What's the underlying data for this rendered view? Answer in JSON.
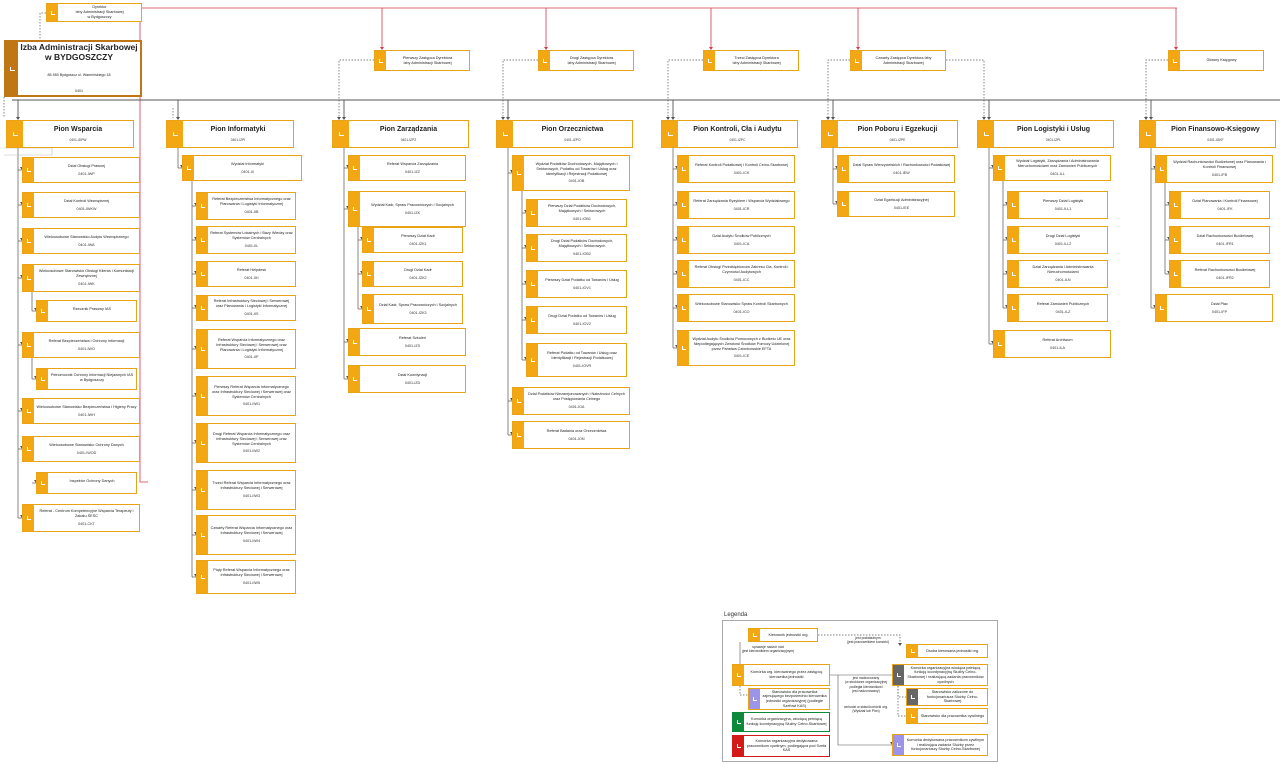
{
  "colors": {
    "accent": "#f3a712",
    "main": "#c07615",
    "grey": "#666666",
    "purple": "#9b94e8",
    "green": "#0c8a3a",
    "red": "#d41919",
    "line": "#555555",
    "redline": "#d43a4a"
  },
  "izba": {
    "name": "Izba Administracji Skarbowej w BYDGOSZCZY",
    "address": "85-950 Bydgoszcz ul. Warmińskiego 18",
    "code": "0401"
  },
  "top": [
    {
      "label": "Dyrektor\nIzby Administracji Skarbowej\nw Bydgoszczy"
    },
    {
      "label": "Pierwszy Zastępca Dyrektora\nIzby Administracji Skarbowej"
    },
    {
      "label": "Drugi Zastępca Dyrektora\nIzby Administracji Skarbowej"
    },
    {
      "label": "Trzeci Zastępca Dyrektora\nIzby Administracji Skarbowej"
    },
    {
      "label": "Czwarty Zastępca Dyrektora Izby\nAdministracji Skarbowej"
    },
    {
      "label": "Główny Księgowy"
    }
  ],
  "pions": [
    {
      "name": "Pion Wsparcia",
      "code": "0401-IDPW",
      "units": [
        {
          "name": "Dział Obsługi Prawnej",
          "code": "0401-IWP"
        },
        {
          "name": "Dział Kontroli Wewnętrznej",
          "code": "0401-IWKW"
        },
        {
          "name": "Wieloosobowe Stanowisko Audytu Wewnętrznego",
          "code": "0401-IWA"
        },
        {
          "name": "Wieloosobowe Stanowisko Obsługi Klienta i Komunikacji Zewnętrznej",
          "code": "0401-IWK"
        },
        {
          "name": "Rzecznik Prasowy IAS",
          "code": ""
        },
        {
          "name": "Referat Bezpieczeństwa i Ochrony Informacji",
          "code": "0401-IWO"
        },
        {
          "name": "Pełnomocnik Ochrony Informacji Niejawnych IAS w Bydgoszczy",
          "code": ""
        },
        {
          "name": "Wieloosobowe Stanowisko Bezpieczeństwa i Higieny Pracy",
          "code": "0401-IWH"
        },
        {
          "name": "Wieloosobowe Stanowisko Ochrony Danych",
          "code": "0401-IWOD"
        },
        {
          "name": "Inspektor Ochrony Danych",
          "code": ""
        },
        {
          "name": "Referat - Centrum Kompetencyjne Wsparcia Terapeuty i Zakatu ŚESC",
          "code": "0401-CKT"
        }
      ]
    },
    {
      "name": "Pion Informatyki",
      "code": "0401-IZPI",
      "units": [
        {
          "name": "Wydział Informatyki",
          "code": "0401-IIl"
        },
        {
          "name": "Referat Bezpieczeństwa Informatycznego oraz Planowania i Logistyki Informatycznej",
          "code": "0401-IIB"
        },
        {
          "name": "Referat Systemów Lokalnych i Bazy Wiedzy oraz Systemów Centralnych",
          "code": "0401-IIL"
        },
        {
          "name": "Referat Helpdesk",
          "code": "0401-IIH"
        },
        {
          "name": "Referat Infrastruktury Sieciowej i Serwerowej oraz Planowania i Logistyki Informatycznej",
          "code": "0401-IIS"
        },
        {
          "name": "Referat Wsparcia Informatycznego oraz Infrastruktury Sieciowej i Serwerowej oraz Planowania i Logistyki Informatycznej",
          "code": "0401-IIP"
        },
        {
          "name": "Pierwszy Referat Wsparcia Informatycznego oraz Infrastruktury Sieciowej i Serwerowej oraz Systemów Centralnych",
          "code": "0401-IIW1"
        },
        {
          "name": "Drugi Referat Wsparcia Informatycznego oraz Infrastruktury Sieciowej i Serwerowej oraz Systemów Centralnych",
          "code": "0401-IIW2"
        },
        {
          "name": "Trzeci Referat Wsparcia Informatycznego oraz Infrastruktury Sieciowej i Serwerowej",
          "code": "0401-IIW3"
        },
        {
          "name": "Czwarty Referat Wsparcia Informatycznego oraz Infrastruktury Sieciowej i Serwerowej",
          "code": "0401-IIW4"
        },
        {
          "name": "Piąty Referat Wsparcia Informatycznego oraz Infrastruktury Sieciowej i Serwerowej",
          "code": "0401-IIW5"
        }
      ]
    },
    {
      "name": "Pion Zarządzania",
      "code": "0401-IZPZ",
      "units": [
        {
          "name": "Referat Wsparcia Zarządzania",
          "code": "0401-IZZ"
        },
        {
          "name": "Wydział Kadr, Spraw Pracowniczych i Socjalnych",
          "code": "0401-IZK"
        },
        {
          "name": "Pierwszy Dział Kadr",
          "code": "0401-IZK1"
        },
        {
          "name": "Drugi Dział Kadr",
          "code": "0401-IZK2"
        },
        {
          "name": "Dział Kadr, Spraw Pracowniczych i Socjalnych",
          "code": "0401-IZK3"
        },
        {
          "name": "Referat Szkoleń",
          "code": "0401-IZS"
        },
        {
          "name": "Dział Koordynacji",
          "code": "0401-IZD"
        }
      ]
    },
    {
      "name": "Pion Orzecznictwa",
      "code": "0401-IZPO",
      "units": [
        {
          "name": "Wydział Podatków Dochodowych, Majątkowych i Sektorowych, Podatku od Towarów i Usług oraz Identyfikacji i Rejestracji Podatkowej",
          "code": "0401-IOB"
        },
        {
          "name": "Pierwszy Dział Podatków Dochodowych, Majątkowych i Sektorowych",
          "code": "0401-IOB1"
        },
        {
          "name": "Drugi Dział Podatków Dochodowych, Majątkowych i Sektorowych",
          "code": "0401-IOB2"
        },
        {
          "name": "Pierwszy Dział Podatku od Towarów i Usług",
          "code": "0401-IOV1"
        },
        {
          "name": "Drugi Dział Podatku od Towarów i Usług",
          "code": "0401-IOV2"
        },
        {
          "name": "Referat Podatku od Towarów i Usług oraz Identyfikacji i Rejestracji Podatkowej",
          "code": "0401-IOVR"
        },
        {
          "name": "Dział Podatków Niezarejonowanych i Należności Celnych oraz Postępowania Celnego",
          "code": "0401-IOA"
        },
        {
          "name": "Referat Badania oraz Orzecznictwa",
          "code": "0401-ION"
        }
      ]
    },
    {
      "name": "Pion Kontroli, Cła i Audytu",
      "code": "0401-IZPC",
      "units": [
        {
          "name": "Referat Kontroli Podatkowej i Kontroli Celno-Skarbowej",
          "code": "0401-ICK"
        },
        {
          "name": "Referat Zarządzania Ryzykiem i Wsparcia Wydziałowego",
          "code": "0401-ICR"
        },
        {
          "name": "Dział Audytu Środków Publicznych",
          "code": "0401-ICA"
        },
        {
          "name": "Referat Obsługi Przedsiębiorców Zakresu Cła, Kontroli i Czynności Audytowych",
          "code": "0401-ICC"
        },
        {
          "name": "Wieloosobowe Stanowisko Spraw Kontroli Skarbowych",
          "code": "0401-ICO"
        },
        {
          "name": "Wydział Audytu Środków Pomocowych z Budżetu UE oraz Niepodlegających Zwrotowi Środków Pomocy Udzielonej przez Państwa Członkowskie EFTA",
          "code": "0401-ICE"
        }
      ]
    },
    {
      "name": "Pion Poboru i Egzekucji",
      "code": "0401-IZPE",
      "units": [
        {
          "name": "Dział Spraw Wierzycielskich i Rachunkowości Podatkowej",
          "code": "0401-IEW"
        },
        {
          "name": "Dział Egzekucji Administracyjnej",
          "code": "0401-IEE"
        }
      ]
    },
    {
      "name": "Pion Logistyki i Usług",
      "code": "0401-IZPL",
      "units": [
        {
          "name": "Wydział Logistyki, Zarządzania i Administrowania Nieruchomościami oraz Zamówień Publicznych",
          "code": "0401-ILL"
        },
        {
          "name": "Pierwszy Dział Logistyki",
          "code": "0401-ILL1"
        },
        {
          "name": "Drugi Dział Logistyki",
          "code": "0401-ILL2"
        },
        {
          "name": "Dział Zarządzania i Administrowania Nieruchomościami",
          "code": "0401-ILN"
        },
        {
          "name": "Referat Zamówień Publicznych",
          "code": "0401-ILZ"
        },
        {
          "name": "Referat Archiwum",
          "code": "0401-ILA"
        }
      ]
    },
    {
      "name": "Pion Finansowo-Księgowy",
      "code": "0401-IGKF",
      "units": [
        {
          "name": "Wydział Rachunkowości Budżetowej oraz Planowania i Kontroli Finansowej",
          "code": "0401-IFB"
        },
        {
          "name": "Dział Planowania i Kontroli Finansowej",
          "code": "0401-IFK"
        },
        {
          "name": "Dział Rachunkowości Budżetowej",
          "code": "0401-IFR1"
        },
        {
          "name": "Referat Rachunkowości Budżetowej",
          "code": "0401-IFR2"
        },
        {
          "name": "Dział Płac",
          "code": "0401-IFP"
        }
      ]
    }
  ],
  "legend": {
    "title": "Legenda",
    "items": [
      "Kierownik jednostki org.",
      "Komórka org. kierowanego przez zastępcę kierownika jednostki",
      "Stanowisko dla pracownika zajmującego bezpośrednio kierownika jednostki organizacyjnej (podległe Szefowi KAS)",
      "Komórka organizacyjna, wiodącą pełniącą funkcję koordynacyjną Służby Celno-Skarbowej",
      "Komórka organizacyjna dedykowana pracownikom cywilnym, podlegająca pod Szefa KAS",
      "Osoba kierowana jednostki org.",
      "Komórka organizacyjna wiodąca pełniącą funkcję koordynacyjną Służby Celno-Skarbowej i realizującą zadania pracowników cywilnych",
      "Stanowisko zaliczone do funkcjonariusza Służby Celno-Skarbowej",
      "Stanowisko dla pracownika cywilnego",
      "Komórka dedykowana pracownikom cywilnym i realizująca zadania Służby przez funkcjonariuszy Służby Celno-Skarbowej"
    ],
    "notes": [
      "jest podwładnym\n(jest pracownikiem komórki)",
      "sprawuje nadzór nad\n(jest kierownikiem organizacyjnym)",
      "jest nadzorowany\n(w strukturze organizacyjnej\npodległa kierownikowi\njest nadzorowany)",
      "wchodzi w skład komórki org.\n(Wydział lub Pion)"
    ]
  }
}
